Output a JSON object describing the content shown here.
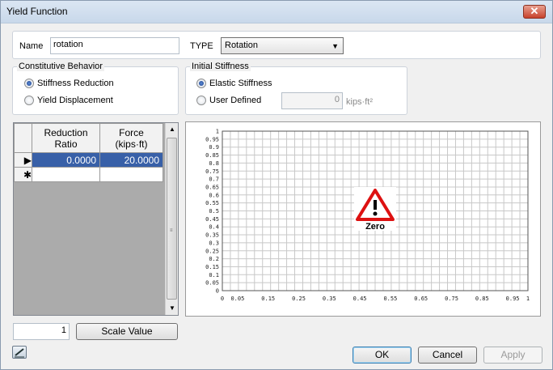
{
  "window": {
    "title": "Yield Function",
    "close_glyph": "✕"
  },
  "name_field": {
    "label": "Name",
    "value": "rotation"
  },
  "type_field": {
    "label": "TYPE",
    "value": "Rotation"
  },
  "constitutive": {
    "title": "Constitutive Behavior",
    "options": [
      {
        "label": "Stiffness Reduction",
        "selected": true
      },
      {
        "label": "Yield Displacement",
        "selected": false
      }
    ]
  },
  "initial_stiffness": {
    "title": "Initial Stiffness",
    "options": [
      {
        "label": "Elastic Stiffness",
        "selected": true
      },
      {
        "label": "User Defined",
        "selected": false
      }
    ],
    "value": "0",
    "unit": "kips·ft²"
  },
  "table": {
    "columns": [
      {
        "line1": "Reduction",
        "line2": "Ratio"
      },
      {
        "line1": "Force",
        "line2": "(kips·ft)"
      }
    ],
    "rows": [
      {
        "marker": "▶",
        "values": [
          "0.0000",
          "20.0000"
        ]
      },
      {
        "marker": "✱",
        "values": [
          "",
          ""
        ]
      }
    ]
  },
  "chart_data": {
    "type": "line",
    "x_ticks": [
      "0",
      "0.05",
      "0.15",
      "0.25",
      "0.35",
      "0.45",
      "0.55",
      "0.65",
      "0.75",
      "0.85",
      "0.95",
      "1"
    ],
    "y_ticks": [
      "1",
      "0.95",
      "0.9",
      "0.85",
      "0.8",
      "0.75",
      "0.7",
      "0.65",
      "0.6",
      "0.55",
      "0.5",
      "0.45",
      "0.4",
      "0.35",
      "0.3",
      "0.25",
      "0.2",
      "0.15",
      "0.1",
      "0.05",
      "0"
    ],
    "xlim": [
      0,
      1
    ],
    "ylim": [
      0,
      1
    ],
    "grid": true,
    "warning_label": "Zero",
    "series": []
  },
  "scale": {
    "value": "1",
    "button_label": "Scale Value"
  },
  "footer": {
    "ok_label": "OK",
    "cancel_label": "Cancel",
    "apply_label": "Apply"
  }
}
